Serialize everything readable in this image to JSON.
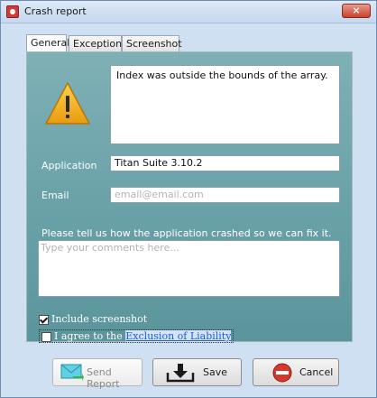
{
  "window": {
    "title": "Crash report",
    "close_label": "×"
  },
  "tabs": [
    {
      "label": "General",
      "active": true
    },
    {
      "label": "Exceptions",
      "active": false
    },
    {
      "label": "Screenshot",
      "active": false
    }
  ],
  "general": {
    "error_message": "Index was outside the bounds of the array.",
    "application_label": "Application",
    "application_value": "Titan Suite 3.10.2",
    "email_label": "Email",
    "email_placeholder": "email@email.com",
    "prompt": "Please tell us how the application crashed so we can fix it.",
    "comments_placeholder": "Type your comments here...",
    "include_screenshot_label": "Include screenshot",
    "include_screenshot_checked": true,
    "agree_prefix": "I agree to the ",
    "agree_link": "Exclusion of Liability",
    "agree_checked": false
  },
  "buttons": {
    "send_report": "Send Report",
    "save": "Save",
    "cancel": "Cancel"
  },
  "icons": {
    "app": "crash-report-app-icon",
    "warning": "warning-icon",
    "send": "envelope-send-icon",
    "save": "download-save-icon",
    "cancel": "no-entry-cancel-icon"
  },
  "colors": {
    "panel": "#6da4ab",
    "warning": "#f2b21d",
    "cancel": "#d43a2c",
    "link": "#1f5fd6"
  }
}
